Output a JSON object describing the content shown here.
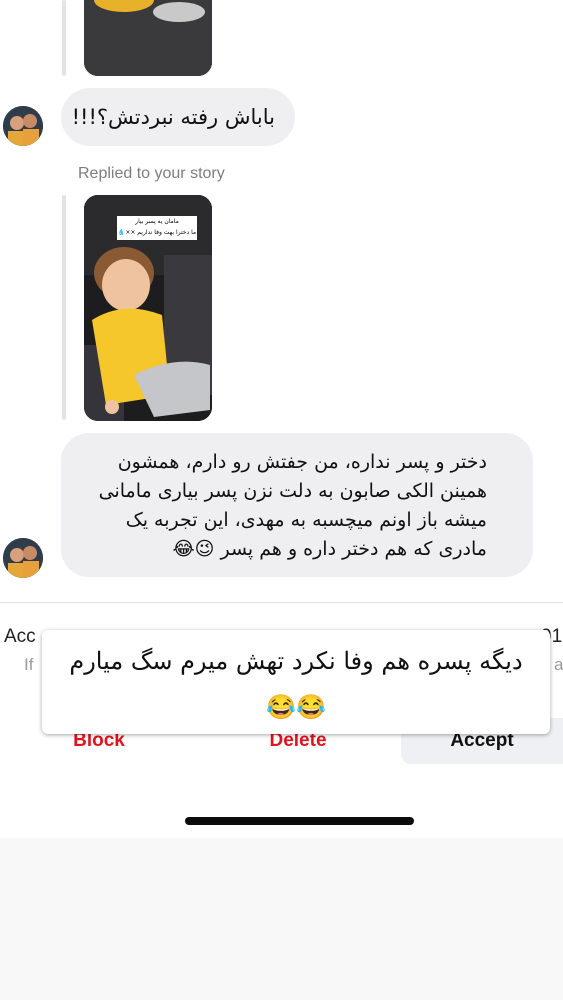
{
  "thread": {
    "message_1": "باباش رفته نبردتش؟!!!",
    "replied_label": "Replied to your story",
    "story_caption": {
      "line1": "مامان یه پسر بیار",
      "line2": "ما دخترا بهت وفا نداریم ××💧"
    },
    "message_2": "دختر و پسر نداره، من جفتش رو دارم، همشون همینن الکی صابون به دلت نزن پسر بیاری مامانی میشه باز اونم میچسبه به مهدی، این تجربه یک مادری که هم دختر داره و هم پسر 😉😂"
  },
  "request_bar": {
    "line1_left": "Acc",
    "line1_right": "91",
    "line2_left": "If",
    "line2_right": "a",
    "block_label": "Block",
    "delete_label": "Delete",
    "accept_label": "Accept"
  },
  "overlay_caption": {
    "text": "دیگه پسره هم وفا نکرد تهش میرم سگ میارم😂😂"
  },
  "colors": {
    "bubble_bg": "#efeff2",
    "danger": "#e0141e",
    "accept_bg": "#eff0f3",
    "meta_text": "#7d7d83"
  },
  "icons": {
    "avatar": "avatar",
    "home_indicator": "home-indicator"
  }
}
